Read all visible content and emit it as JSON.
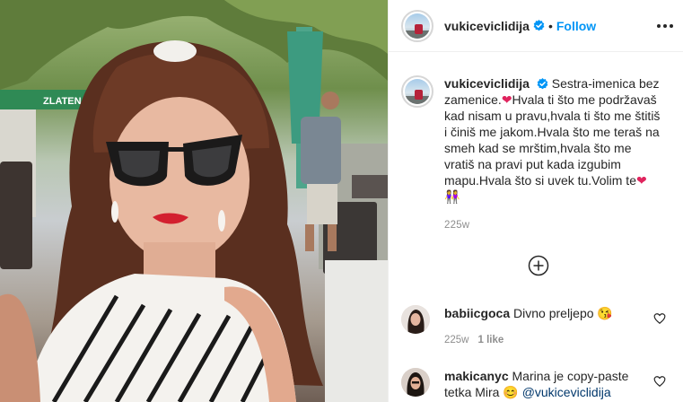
{
  "post": {
    "username": "vukiceviclidija",
    "verified": true,
    "separator": "•",
    "follow_label": "Follow",
    "more_icon": "more-options-icon",
    "caption": {
      "username": "vukiceviclidija",
      "line1": "Sestra-imenica bez zamenice.",
      "heart": "❤",
      "line2": "Hvala ti što me podržavaš kad nisam u pravu,hvala ti što me štitiš i činiš me jakom.Hvala što me teraš na smeh kad se mrštim,hvala što me vratiš na pravi put kada izgubim mapu.Hvala što si uvek tu.Volim te",
      "heart2": "❤",
      "emoji": "👭",
      "age": "225w"
    },
    "load_more_icon": "plus-circle-icon"
  },
  "comments": [
    {
      "username": "babiicgoca",
      "text": "Divno preljepo",
      "emoji": "😘",
      "age": "225w",
      "likes": "1 like"
    },
    {
      "username": "makicanyc",
      "text": "Marina je copy-paste tetka Mira",
      "emoji": "😊",
      "mention": "@vukiceviclidija"
    }
  ],
  "photo": {
    "sign_text": "ZLATEN"
  },
  "colors": {
    "accent": "#0095f6",
    "heart": "#e0245e",
    "meta": "#8e8e8e",
    "text": "#262626",
    "lips": "#d3202f"
  }
}
